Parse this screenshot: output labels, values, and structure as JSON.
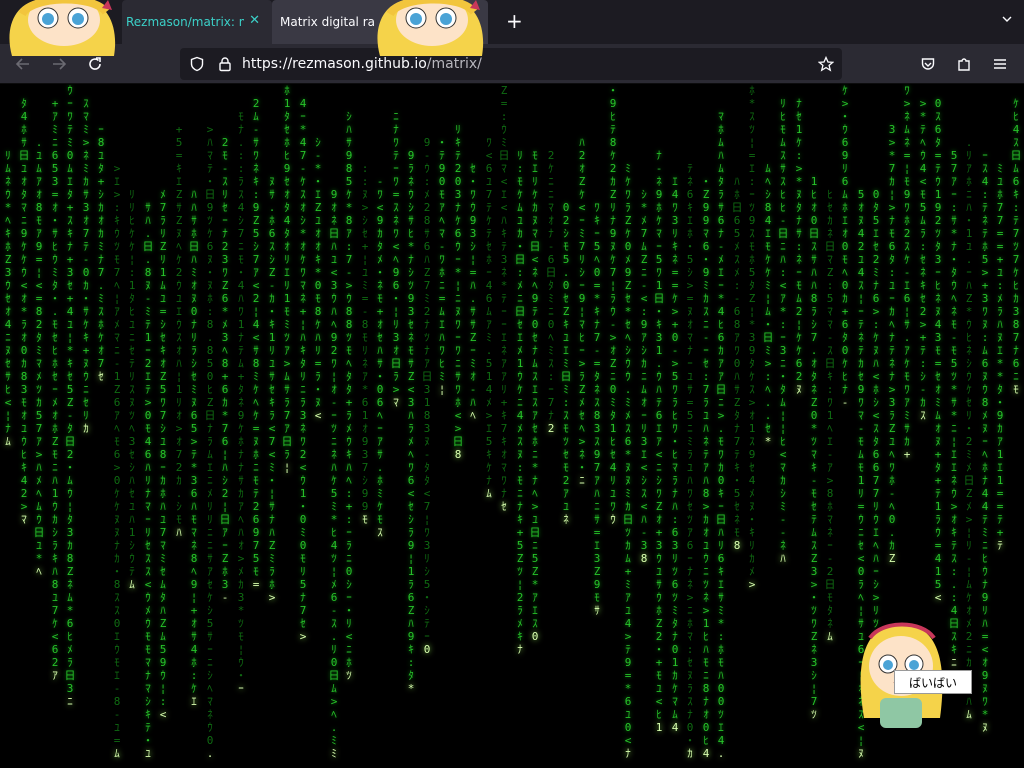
{
  "browser": {
    "tabs": [
      {
        "title": "Rezmason/matrix: ma",
        "active": false
      },
      {
        "title": "Matrix digital rain",
        "active": true
      }
    ],
    "close_glyph": "✕",
    "new_tab_glyph": "+",
    "url_host": "https://rezmason.github.io",
    "url_path": "/matrix/",
    "icons": [
      "back-arrow-icon",
      "forward-arrow-icon",
      "reload-icon",
      "shield-icon",
      "lock-icon",
      "bookmark-star-icon",
      "pocket-icon",
      "extensions-icon",
      "menu-icon",
      "list-all-tabs-icon"
    ]
  },
  "overlay": {
    "speech_bubble": "ばいばい"
  },
  "colors": {
    "rain": "#27c32a",
    "rain_dim": "#0f6b12",
    "rain_head": "#d9ffb0",
    "tab_accent": "#3bd0c8",
    "background": "#000000"
  },
  "rain_glyphs": "ﾊﾐﾋｰｳｼﾅﾓﾆｻﾜﾂｵﾘｱﾎﾃﾏｹﾒｴｶｷﾑﾕﾗｾﾈｽﾀﾇﾍ0123456789Z:・.=*+-<>¦日"
}
